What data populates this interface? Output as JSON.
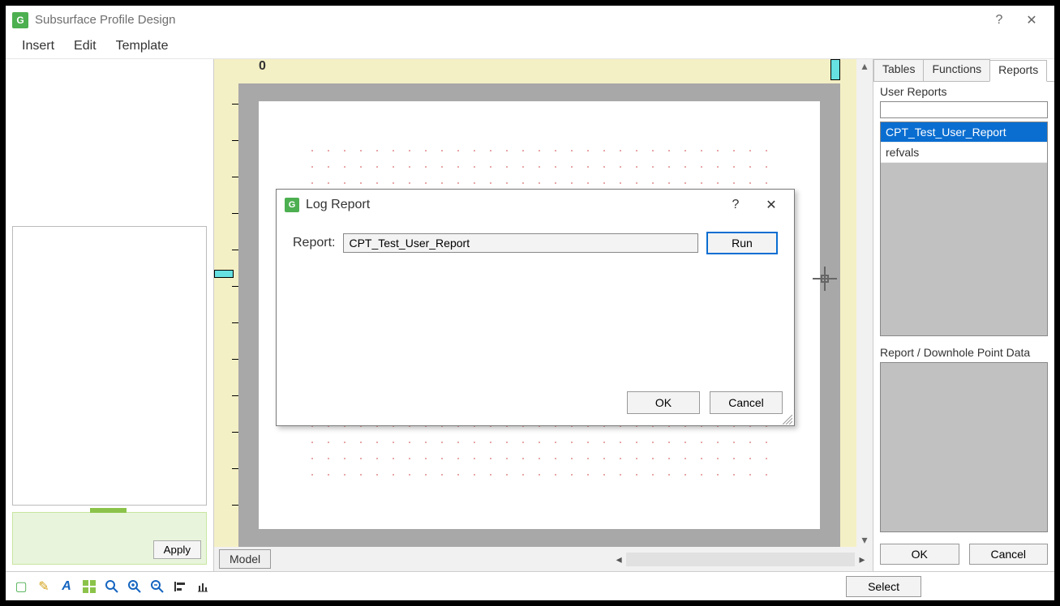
{
  "window": {
    "title": "Subsurface Profile Design",
    "help": "?",
    "close": "✕"
  },
  "menu": {
    "insert": "Insert",
    "edit": "Edit",
    "template": "Template"
  },
  "left": {
    "apply": "Apply"
  },
  "canvas": {
    "origin": "0",
    "model_tab": "Model"
  },
  "right": {
    "tabs": {
      "tables": "Tables",
      "functions": "Functions",
      "reports": "Reports"
    },
    "user_reports_label": "User Reports",
    "reports": {
      "0": {
        "name": "CPT_Test_User_Report"
      },
      "1": {
        "name": "refvals"
      }
    },
    "point_data_label": "Report / Downhole Point Data",
    "ok": "OK",
    "cancel": "Cancel"
  },
  "bottom": {
    "select": "Select"
  },
  "modal": {
    "title": "Log Report",
    "help": "?",
    "close": "✕",
    "report_label": "Report:",
    "report_value": "CPT_Test_User_Report",
    "run": "Run",
    "ok": "OK",
    "cancel": "Cancel"
  }
}
